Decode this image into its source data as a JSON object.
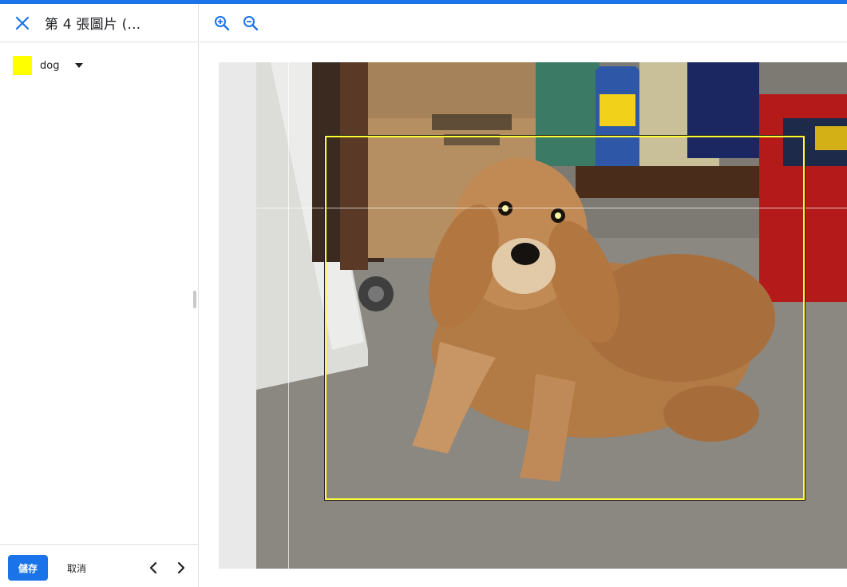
{
  "header": {
    "title": "第 4 張圖片 (..."
  },
  "labels": [
    {
      "name": "dog",
      "color": "#ffff00"
    }
  ],
  "footer": {
    "save_label": "儲存",
    "cancel_label": "取消"
  },
  "colors": {
    "accent": "#1a73e8",
    "bbox": "#ffff33"
  },
  "icons": {
    "close": "close-icon",
    "zoom_in": "zoom-in-icon",
    "zoom_out": "zoom-out-icon",
    "prev": "chevron-left-icon",
    "next": "chevron-right-icon",
    "dropdown": "caret-down-icon"
  }
}
